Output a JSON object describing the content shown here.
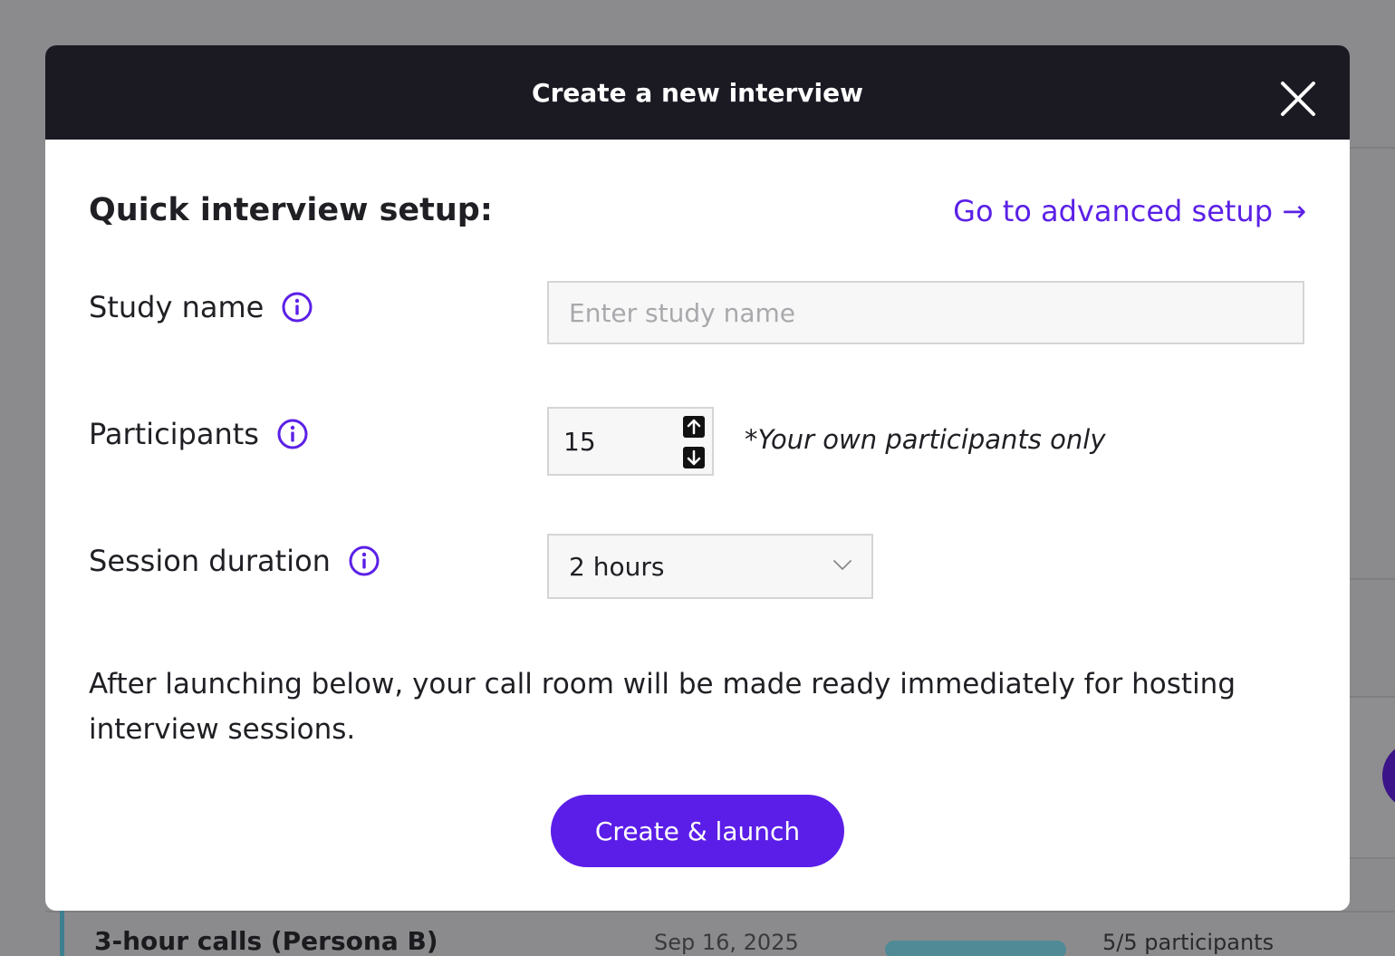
{
  "background": {
    "row": {
      "title": "3-hour calls (Persona B)",
      "date": "Sep 16, 2025",
      "participants": "5/5 participants"
    }
  },
  "modal": {
    "title": "Create a new interview",
    "close_icon": "close-icon",
    "heading": "Quick interview setup:",
    "advanced_link": "Go to advanced setup →",
    "fields": {
      "study_name": {
        "label": "Study name",
        "placeholder": "Enter study name",
        "value": ""
      },
      "participants": {
        "label": "Participants",
        "value": "15",
        "note": "*Your own participants only"
      },
      "session_duration": {
        "label": "Session duration",
        "value": "2 hours"
      }
    },
    "description": "After launching below, your call room will be made ready immediately for hosting interview sessions.",
    "submit_label": "Create & launch"
  },
  "colors": {
    "accent": "#5b1ee8",
    "header_bg": "#1b1a23",
    "link": "#5b20e6"
  }
}
